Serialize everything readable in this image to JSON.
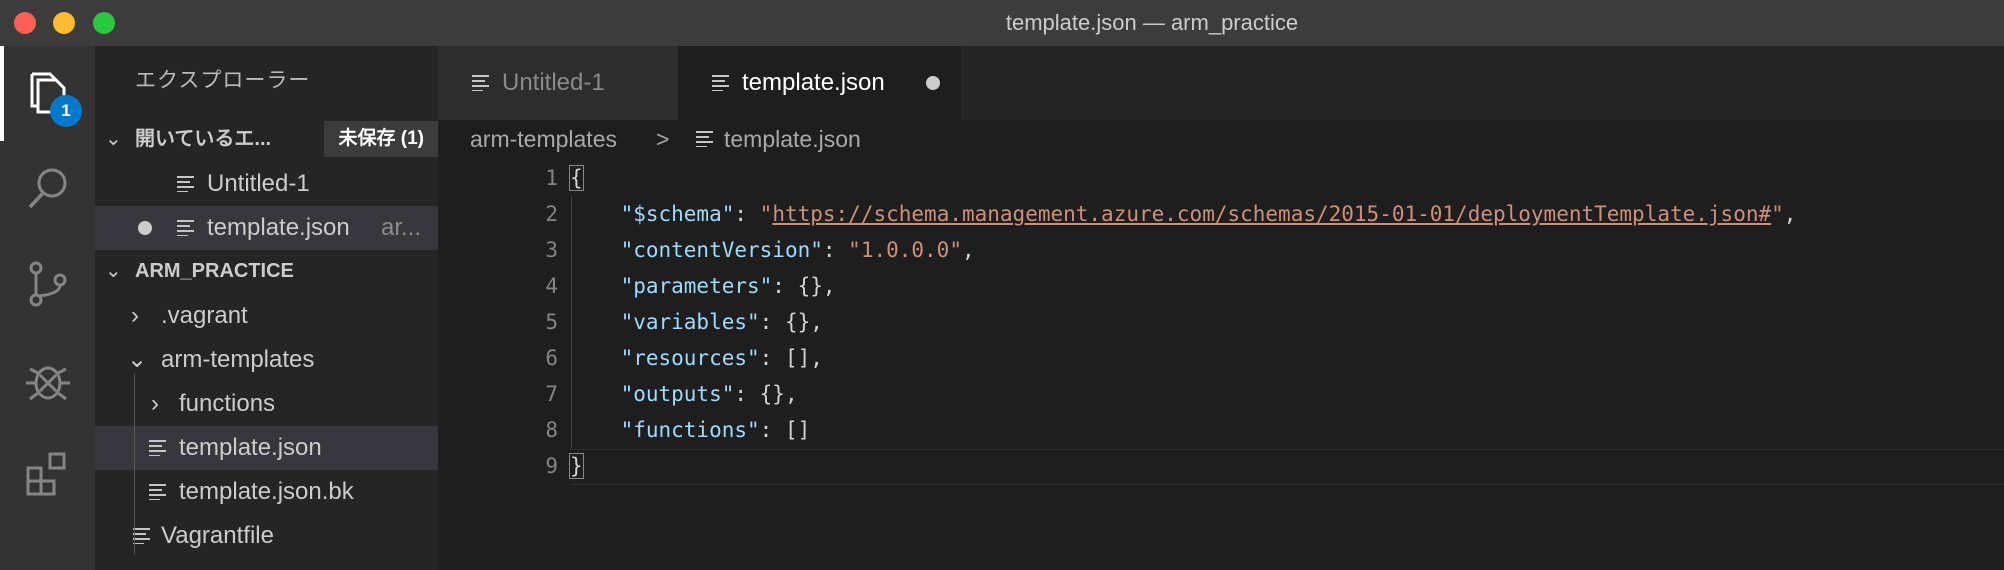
{
  "window": {
    "title": "template.json — arm_practice"
  },
  "activity_bar": {
    "items": [
      {
        "icon": "files-icon",
        "active": true
      },
      {
        "icon": "search-icon",
        "active": false
      },
      {
        "icon": "source-control-icon",
        "active": false
      },
      {
        "icon": "debug-icon",
        "active": false
      },
      {
        "icon": "extensions-icon",
        "active": false
      }
    ],
    "explorer_badge": "1"
  },
  "sidebar": {
    "title": "エクスプローラー",
    "open_editors": {
      "label": "開いているエ...",
      "unsaved_badge": "未保存 (1)",
      "items": [
        {
          "name": "Untitled-1",
          "dirty": false,
          "path": ""
        },
        {
          "name": "template.json",
          "dirty": true,
          "path": "ar..."
        }
      ]
    },
    "workspace": {
      "label": "ARM_PRACTICE",
      "items": [
        {
          "name": ".vagrant",
          "type": "folder",
          "expanded": false
        },
        {
          "name": "arm-templates",
          "type": "folder",
          "expanded": true
        },
        {
          "name": "functions",
          "type": "folder",
          "expanded": false
        },
        {
          "name": "template.json",
          "type": "file",
          "selected": true
        },
        {
          "name": "template.json.bk",
          "type": "file"
        },
        {
          "name": "Vagrantfile",
          "type": "file"
        }
      ]
    }
  },
  "tabs": [
    {
      "label": "Untitled-1",
      "active": false
    },
    {
      "label": "template.json",
      "active": true,
      "dirty": true
    }
  ],
  "breadcrumb": {
    "folder": "arm-templates",
    "separator": ">",
    "file": "template.json"
  },
  "editor": {
    "line_numbers": [
      "1",
      "2",
      "3",
      "4",
      "5",
      "6",
      "7",
      "8",
      "9"
    ],
    "lines": {
      "l1_brace": "{",
      "l2_key": "\"$schema\"",
      "l2_colon": ": ",
      "l2_q1": "\"",
      "l2_url": "https://schema.management.azure.com/schemas/2015-01-01/deploymentTemplate.json#",
      "l2_q2": "\"",
      "l2_tail": ",",
      "l3_key": "\"contentVersion\"",
      "l3_colon": ": ",
      "l3_val": "\"1.0.0.0\"",
      "l3_tail": ",",
      "l4_key": "\"parameters\"",
      "l4_rest": ": {},",
      "l5_key": "\"variables\"",
      "l5_rest": ": {},",
      "l6_key": "\"resources\"",
      "l6_rest": ": [],",
      "l7_key": "\"outputs\"",
      "l7_rest": ": {},",
      "l8_key": "\"functions\"",
      "l8_rest": ": []",
      "l9_brace": "}"
    }
  },
  "colors": {
    "accent": "#007acc",
    "key": "#9cdcfe",
    "string": "#ce9178"
  }
}
